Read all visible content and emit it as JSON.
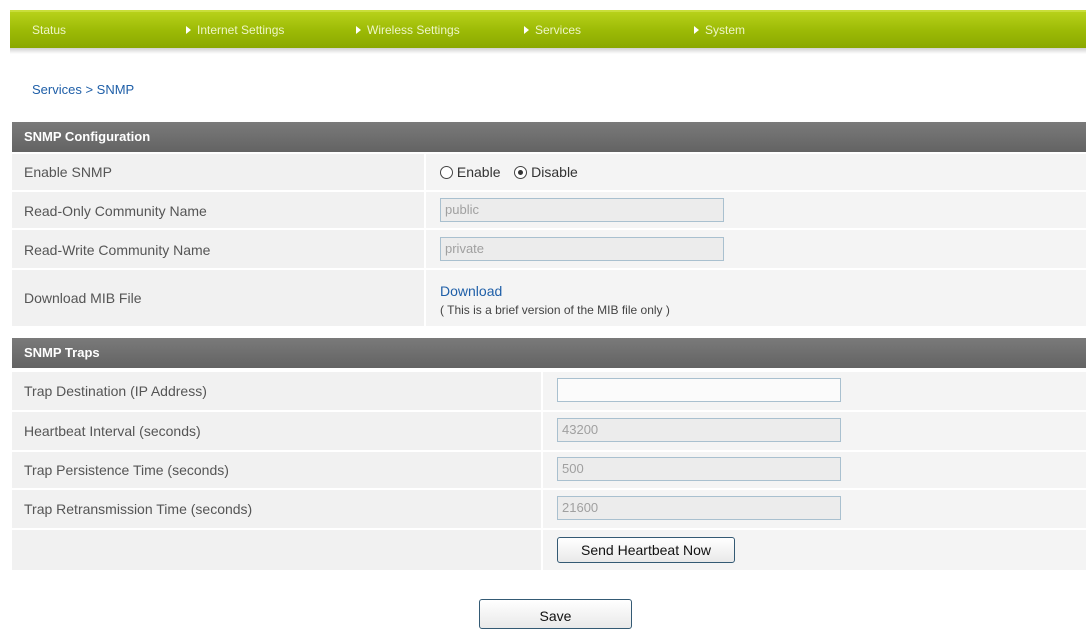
{
  "nav": {
    "items": [
      {
        "label": "Status",
        "arrow": false
      },
      {
        "label": "Internet Settings",
        "arrow": true
      },
      {
        "label": "Wireless Settings",
        "arrow": true
      },
      {
        "label": "Services",
        "arrow": true
      },
      {
        "label": "System",
        "arrow": true
      }
    ]
  },
  "breadcrumb": "Services > SNMP",
  "snmp_config": {
    "title": "SNMP Configuration",
    "enable_label": "Enable SNMP",
    "enable_option": "Enable",
    "disable_option": "Disable",
    "selected": "Disable",
    "ro_label": "Read-Only Community Name",
    "ro_value": "public",
    "rw_label": "Read-Write Community Name",
    "rw_value": "private",
    "mib_label": "Download MIB File",
    "mib_link": "Download",
    "mib_note": "( This is a brief version of the MIB file only )"
  },
  "snmp_traps": {
    "title": "SNMP Traps",
    "dest_label": "Trap Destination (IP Address)",
    "dest_value": "",
    "heartbeat_label": "Heartbeat Interval (seconds)",
    "heartbeat_value": "43200",
    "persistence_label": "Trap Persistence Time (seconds)",
    "persistence_value": "500",
    "retrans_label": "Trap Retransmission Time (seconds)",
    "retrans_value": "21600",
    "send_button": "Send Heartbeat Now"
  },
  "save_button": "Save",
  "colors": {
    "nav_green": "#9dbb06",
    "header_gray": "#6e6e6e",
    "link_blue": "#1f5fa8"
  }
}
